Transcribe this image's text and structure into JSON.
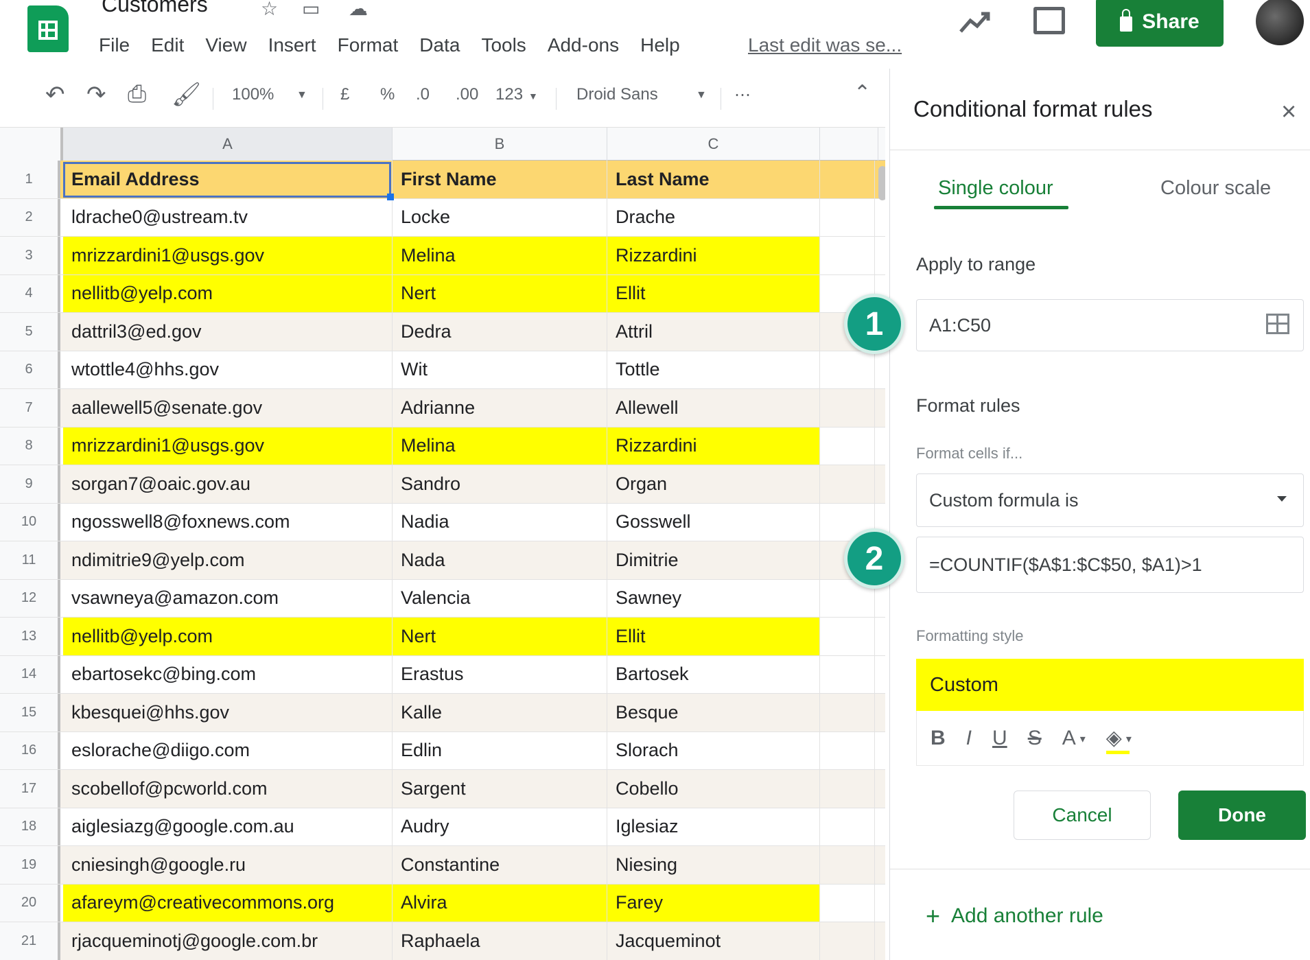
{
  "app": {
    "title": "Customers",
    "menu": [
      "File",
      "Edit",
      "View",
      "Insert",
      "Format",
      "Data",
      "Tools",
      "Add-ons",
      "Help"
    ],
    "last_edit": "Last edit was se...",
    "share_label": "Share"
  },
  "toolbar": {
    "zoom": "100%",
    "currency": "£",
    "percent": "%",
    "decrease_decimal": ".0",
    "increase_decimal": ".00",
    "more_formats": "123",
    "font": "Droid Sans",
    "more": "⋯"
  },
  "sheet": {
    "columns": [
      "A",
      "B",
      "C"
    ],
    "rows": [
      {
        "n": "1",
        "a": "Email Address",
        "b": "First Name",
        "c": "Last Name",
        "style": "header"
      },
      {
        "n": "2",
        "a": "ldrache0@ustream.tv",
        "b": "Locke",
        "c": "Drache",
        "style": "normal"
      },
      {
        "n": "3",
        "a": "mrizzardini1@usgs.gov",
        "b": "Melina",
        "c": "Rizzardini",
        "style": "highlight"
      },
      {
        "n": "4",
        "a": "nellitb@yelp.com",
        "b": "Nert",
        "c": "Ellit",
        "style": "highlight"
      },
      {
        "n": "5",
        "a": "dattril3@ed.gov",
        "b": "Dedra",
        "c": "Attril",
        "style": "normal"
      },
      {
        "n": "6",
        "a": "wtottle4@hhs.gov",
        "b": "Wit",
        "c": "Tottle",
        "style": "normal"
      },
      {
        "n": "7",
        "a": "aallewell5@senate.gov",
        "b": "Adrianne",
        "c": "Allewell",
        "style": "normal"
      },
      {
        "n": "8",
        "a": "mrizzardini1@usgs.gov",
        "b": "Melina",
        "c": "Rizzardini",
        "style": "highlight"
      },
      {
        "n": "9",
        "a": "sorgan7@oaic.gov.au",
        "b": "Sandro",
        "c": "Organ",
        "style": "normal"
      },
      {
        "n": "10",
        "a": "ngosswell8@foxnews.com",
        "b": "Nadia",
        "c": "Gosswell",
        "style": "normal"
      },
      {
        "n": "11",
        "a": "ndimitrie9@yelp.com",
        "b": "Nada",
        "c": "Dimitrie",
        "style": "normal"
      },
      {
        "n": "12",
        "a": "vsawneya@amazon.com",
        "b": "Valencia",
        "c": "Sawney",
        "style": "normal"
      },
      {
        "n": "13",
        "a": "nellitb@yelp.com",
        "b": "Nert",
        "c": "Ellit",
        "style": "highlight"
      },
      {
        "n": "14",
        "a": "ebartosekc@bing.com",
        "b": "Erastus",
        "c": "Bartosek",
        "style": "normal"
      },
      {
        "n": "15",
        "a": "kbesquei@hhs.gov",
        "b": "Kalle",
        "c": "Besque",
        "style": "normal"
      },
      {
        "n": "16",
        "a": "eslorache@diigo.com",
        "b": "Edlin",
        "c": "Slorach",
        "style": "normal"
      },
      {
        "n": "17",
        "a": "scobellof@pcworld.com",
        "b": "Sargent",
        "c": "Cobello",
        "style": "normal"
      },
      {
        "n": "18",
        "a": "aiglesiazg@google.com.au",
        "b": "Audry",
        "c": "Iglesiaz",
        "style": "normal"
      },
      {
        "n": "19",
        "a": "cniesingh@google.ru",
        "b": "Constantine",
        "c": "Niesing",
        "style": "normal"
      },
      {
        "n": "20",
        "a": "afareym@creativecommons.org",
        "b": "Alvira",
        "c": "Farey",
        "style": "highlight"
      },
      {
        "n": "21",
        "a": "rjacqueminotj@google.com.br",
        "b": "Raphaela",
        "c": "Jacqueminot",
        "style": "normal"
      }
    ]
  },
  "panel": {
    "title": "Conditional format rules",
    "tab_single": "Single colour",
    "tab_scale": "Colour scale",
    "apply_label": "Apply to range",
    "range_value": "A1:C50",
    "format_rules_label": "Format rules",
    "format_cells_if": "Format cells if...",
    "condition": "Custom formula is",
    "formula": "=COUNTIF($A$1:$C$50, $A1)>1",
    "formatting_style_label": "Formatting style",
    "style_name": "Custom",
    "style_tools": [
      "B",
      "I",
      "U",
      "S",
      "A"
    ],
    "cancel": "Cancel",
    "done": "Done",
    "add_rule": "Add another rule",
    "badge1": "1",
    "badge2": "2"
  },
  "colors": {
    "brand_green": "#188038",
    "highlight": "#ffff00",
    "header_fill": "#fcd771",
    "badge_teal": "#139e83"
  }
}
